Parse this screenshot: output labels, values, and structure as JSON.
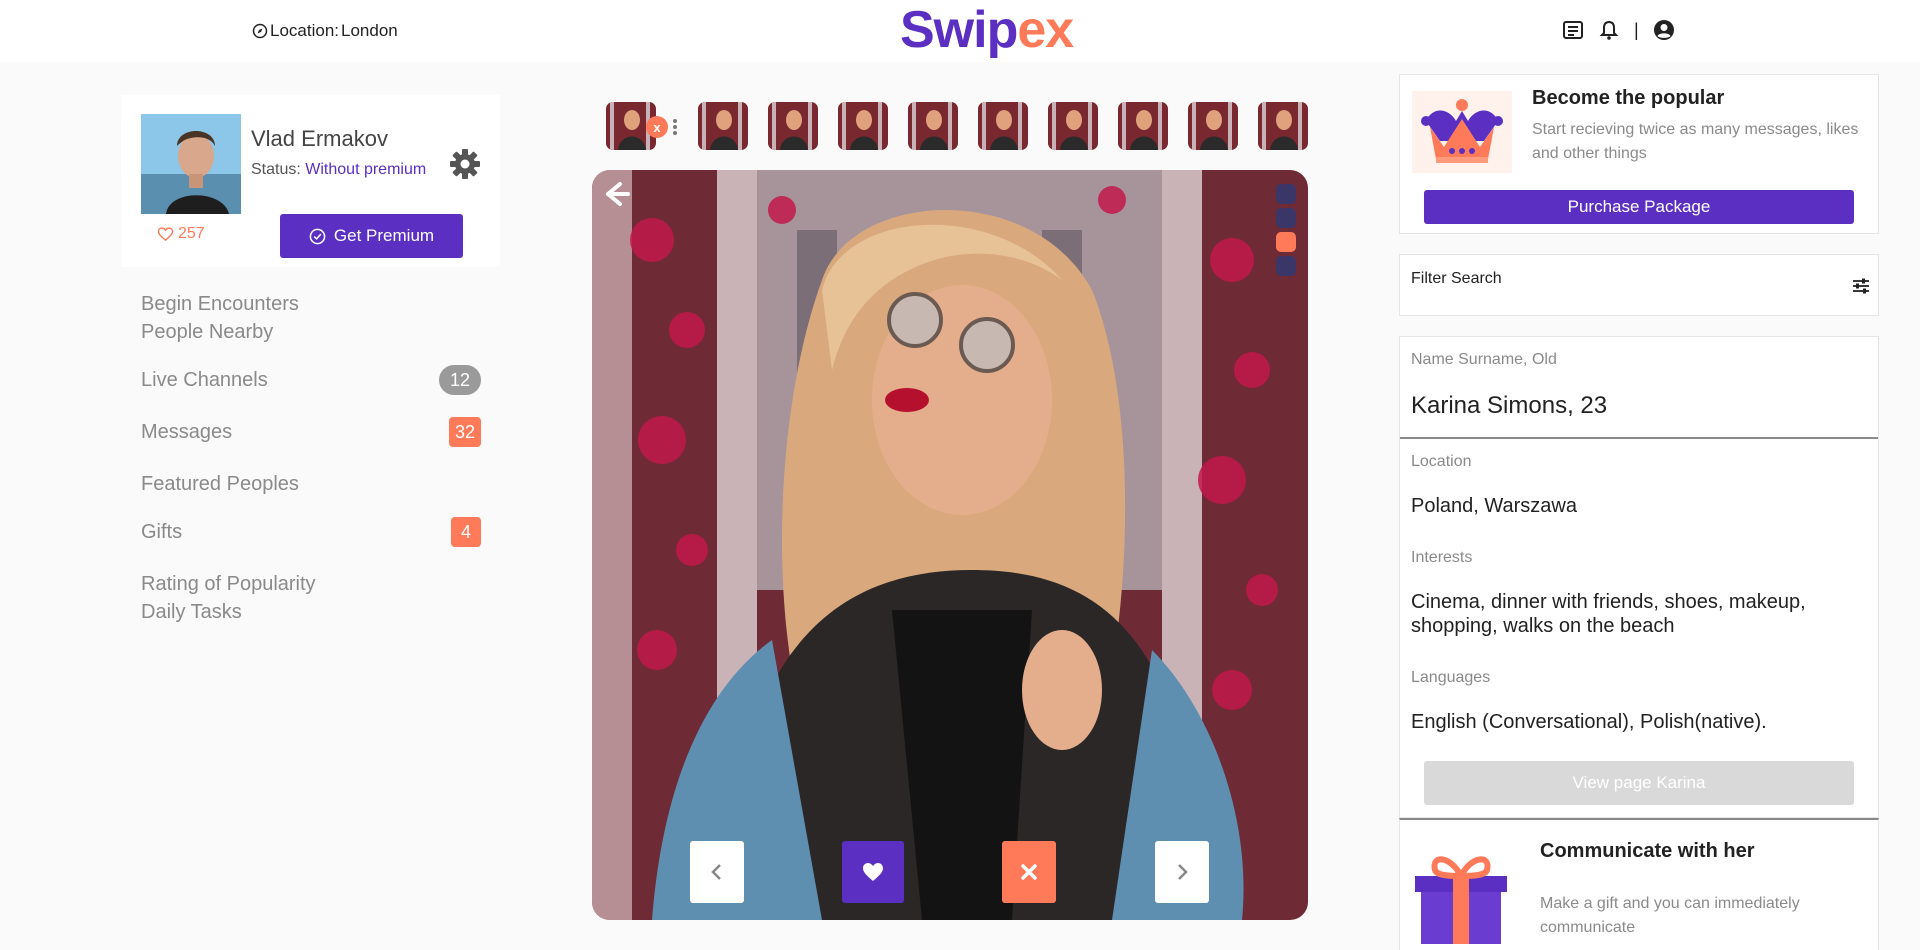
{
  "header": {
    "location_label": "Location:",
    "location_value": "London",
    "logo_part1": "Swip",
    "logo_part2": "ex",
    "separator": "|"
  },
  "profile": {
    "name": "Vlad Ermakov",
    "status_label": "Status:",
    "status_value": "Without premium",
    "likes": "257",
    "premium_button": "Get Premium"
  },
  "nav": {
    "items": [
      {
        "label": "Begin Encounters"
      },
      {
        "label": "People Nearby"
      },
      {
        "label": "Live Channels",
        "badge": "12"
      },
      {
        "label": "Messages",
        "badge": "32"
      },
      {
        "label": "Featured Peoples"
      },
      {
        "label": "Gifts",
        "badge": "4"
      },
      {
        "label": "Rating of Popularity"
      },
      {
        "label": "Daily Tasks"
      }
    ]
  },
  "thumbnails": {
    "remove_label": "x"
  },
  "photo": {
    "active_dot": 2
  },
  "promo": {
    "title": "Become the popular",
    "text": "Start recieving twice as many messages, likes and other things",
    "button": "Purchase Package"
  },
  "filter": {
    "label": "Filter Search"
  },
  "details": {
    "name_label": "Name Surname, Old",
    "name_value": "Karina Simons, 23",
    "location_label": "Location",
    "location_value": "Poland, Warszawa",
    "interests_label": "Interests",
    "interests_value": "Cinema, dinner with friends, shoes, makeup, shopping, walks on the beach",
    "languages_label": "Languages",
    "languages_value": "English (Conversational), Polish(native).",
    "view_button": "View page Karina"
  },
  "gift": {
    "title": "Communicate with her",
    "text": "Make a gift and you can immediately communicate"
  },
  "colors": {
    "brand_purple": "#5a2fc2",
    "brand_orange": "#ff7a59"
  }
}
